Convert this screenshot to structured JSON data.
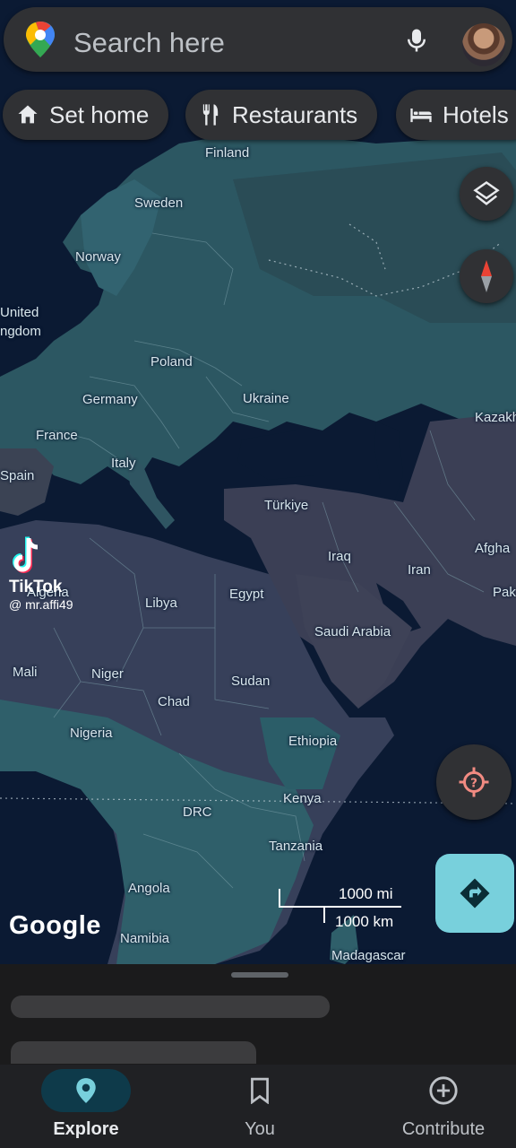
{
  "search": {
    "placeholder": "Search here"
  },
  "chips": [
    {
      "label": "Set home",
      "icon": "home-icon"
    },
    {
      "label": "Restaurants",
      "icon": "fork-knife-icon"
    },
    {
      "label": "Hotels",
      "icon": "bed-icon"
    }
  ],
  "map": {
    "countries": [
      "Finland",
      "Sweden",
      "Norway",
      "United",
      "ngdom",
      "Poland",
      "Germany",
      "Ukraine",
      "Kazakh",
      "France",
      "Italy",
      "Spain",
      "Türkiye",
      "Afgha",
      "Iraq",
      "Iran",
      "Pak",
      "Algeria",
      "Libya",
      "Egypt",
      "Saudi Arabia",
      "Mali",
      "Niger",
      "Chad",
      "Sudan",
      "Nigeria",
      "Ethiopia",
      "Kenya",
      "DRC",
      "Tanzania",
      "Angola",
      "Namibia",
      "Madagascar"
    ],
    "attribution": "Google",
    "scale_mi": "1000  mi",
    "scale_km": "1000  km"
  },
  "watermark": {
    "name": "TikTok",
    "handle": "@ mr.affi49"
  },
  "nav": [
    {
      "label": "Explore",
      "icon": "location-pin-icon"
    },
    {
      "label": "You",
      "icon": "bookmark-icon"
    },
    {
      "label": "Contribute",
      "icon": "plus-circle-icon"
    }
  ],
  "colors": {
    "accent": "#78d0dc",
    "locate": "#f28b82"
  }
}
